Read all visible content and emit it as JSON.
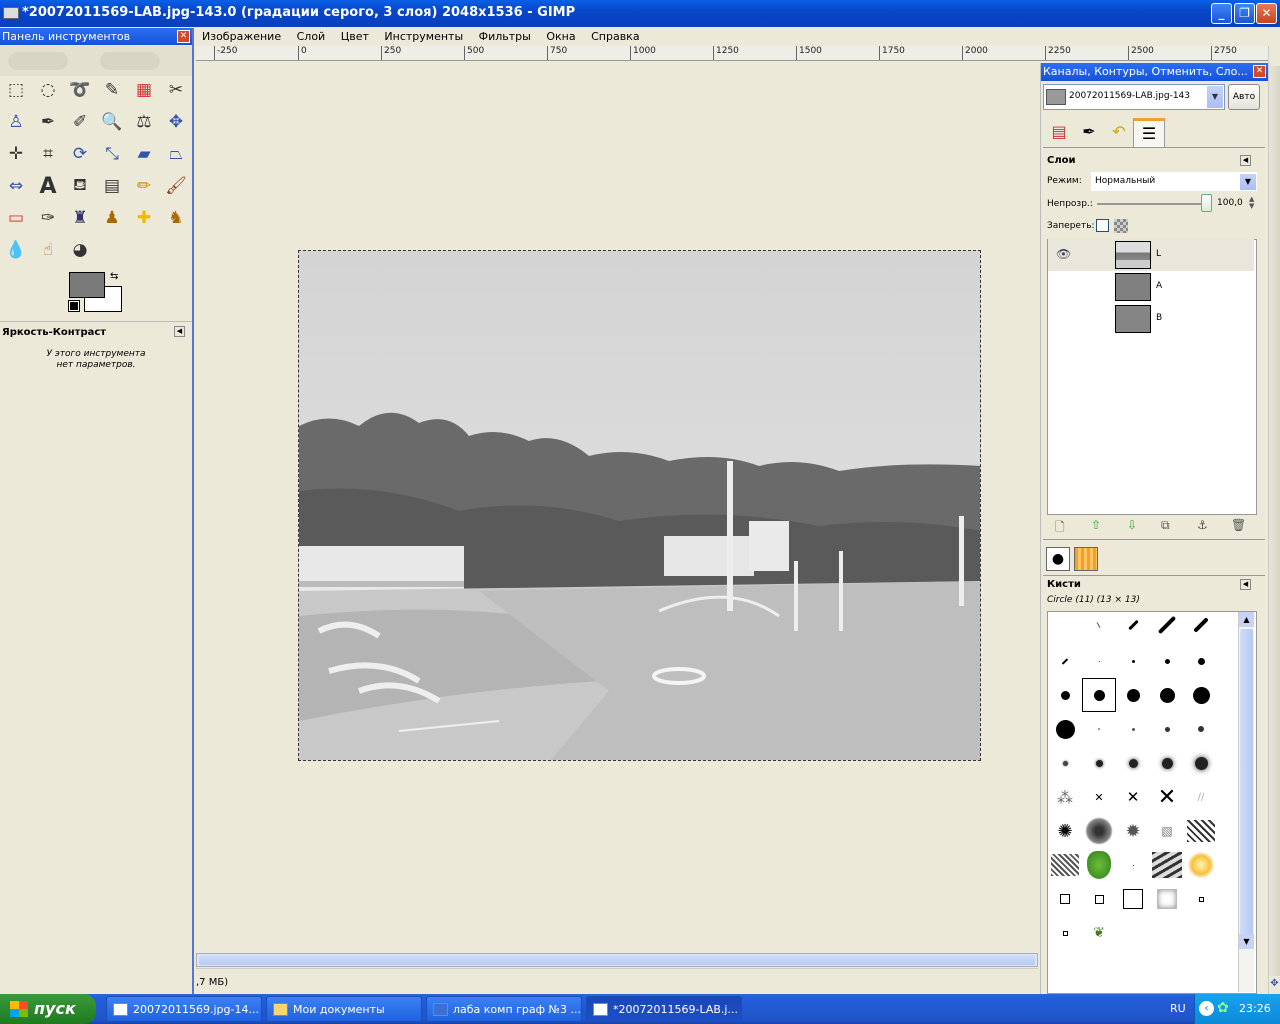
{
  "window": {
    "title": "*20072011569-LAB.jpg-143.0 (градации серого, 3 слоя) 2048x1536 - GIMP"
  },
  "toolbox": {
    "title": "Панель инструментов",
    "tool_options_title": "Яркость-Контраст",
    "tool_options_text_1": "У этого инструмента",
    "tool_options_text_2": "нет параметров."
  },
  "menu": {
    "items": [
      "Изображение",
      "Слой",
      "Цвет",
      "Инструменты",
      "Фильтры",
      "Окна",
      "Справка"
    ]
  },
  "ruler": {
    "labels": [
      "-250",
      "0",
      "250",
      "500",
      "750",
      "1000",
      "1250",
      "1500",
      "1750",
      "2000",
      "2250",
      "2500",
      "2750"
    ]
  },
  "status": {
    "text": ",7 МБ)"
  },
  "dock": {
    "title": "Каналы, Контуры, Отменить, Сло...",
    "image_select": "20072011569-LAB.jpg-143",
    "auto_button": "Авто",
    "layers_title": "Слои",
    "mode_label": "Режим:",
    "mode_value": "Нормальный",
    "opacity_label": "Непрозр.:",
    "opacity_value": "100,0",
    "lock_label": "Запереть:",
    "layers": [
      {
        "name": "L"
      },
      {
        "name": "A"
      },
      {
        "name": "B"
      }
    ],
    "brushes_title": "Кисти",
    "brush_selected": "Circle (11) (13 × 13)"
  },
  "taskbar": {
    "start": "пуск",
    "items": [
      {
        "label": "20072011569.jpg-14..."
      },
      {
        "label": "Мои документы"
      },
      {
        "label": "лаба комп граф №3 ..."
      },
      {
        "label": "*20072011569-LAB.j..."
      }
    ],
    "lang": "RU",
    "clock": "23:26"
  }
}
